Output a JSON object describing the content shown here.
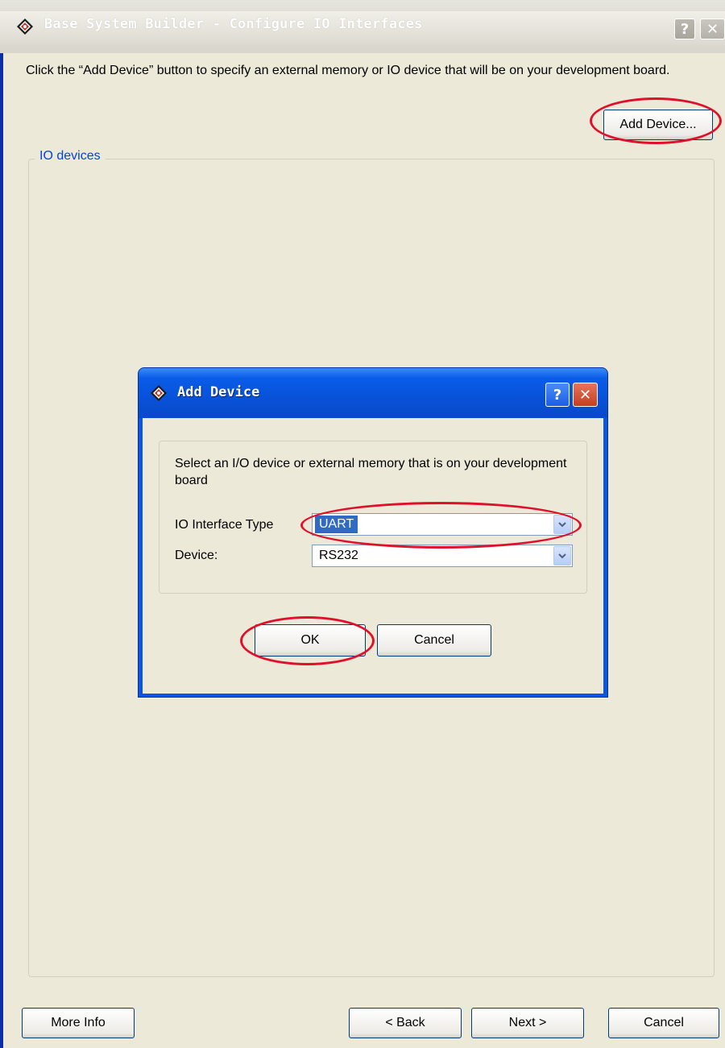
{
  "main_window": {
    "title": "Base System Builder - Configure IO Interfaces",
    "help_glyph": "?",
    "close_glyph": "✕",
    "instruction": "Click the “Add Device” button to specify an external memory or IO device that will be on your development board.",
    "add_device_label": "Add Device...",
    "group_label": "IO devices",
    "buttons": {
      "more_info": "More Info",
      "back": "< Back",
      "next": "Next >",
      "cancel": "Cancel"
    }
  },
  "dialog": {
    "title": "Add Device",
    "help_glyph": "?",
    "close_glyph": "✕",
    "prompt": "Select an I/O device or external memory that is on your development board",
    "io_interface_type_label": "IO Interface Type",
    "io_interface_type_value": "UART",
    "device_label": "Device:",
    "device_value": "RS232",
    "ok_label": "OK",
    "cancel_label": "Cancel"
  },
  "icons": [
    "app-icon",
    "help-icon",
    "close-icon",
    "dropdown-arrow-icon"
  ],
  "colors": {
    "dialog_titlebar": "#0852d8",
    "annotation": "#e0102a",
    "selected_highlight": "#316ac5",
    "window_face": "#ece9d8"
  }
}
